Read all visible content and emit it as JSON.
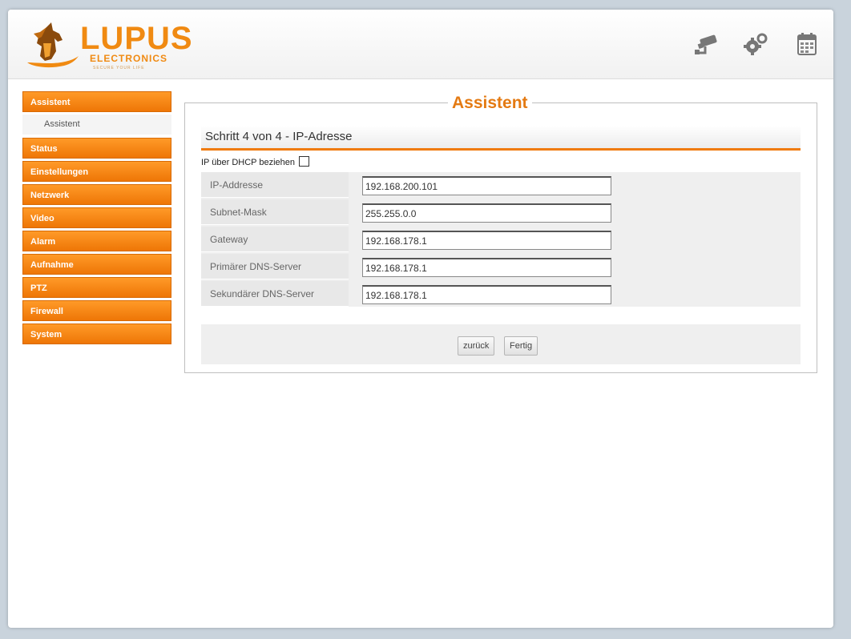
{
  "brand": {
    "name": "LUPUS",
    "sub": "ELECTRONICS",
    "tagline": "SECURE YOUR LIFE",
    "accent_color": "#f08a12"
  },
  "header_icons": [
    "camera-icon",
    "gears-icon",
    "calendar-icon"
  ],
  "nav": {
    "items": [
      {
        "label": "Assistent",
        "active": true,
        "sub": [
          "Assistent"
        ]
      },
      {
        "label": "Status"
      },
      {
        "label": "Einstellungen"
      },
      {
        "label": "Netzwerk"
      },
      {
        "label": "Video"
      },
      {
        "label": "Alarm"
      },
      {
        "label": "Aufnahme"
      },
      {
        "label": "PTZ"
      },
      {
        "label": "Firewall"
      },
      {
        "label": "System"
      }
    ]
  },
  "panel": {
    "title": "Assistent",
    "step": "Schritt 4 von 4 - IP-Adresse",
    "dhcp_label": "IP über DHCP beziehen",
    "dhcp_checked": false,
    "fields": [
      {
        "label": "IP-Addresse",
        "value": "192.168.200.101"
      },
      {
        "label": "Subnet-Mask",
        "value": "255.255.0.0"
      },
      {
        "label": "Gateway",
        "value": "192.168.178.1"
      },
      {
        "label": "Primärer DNS-Server",
        "value": "192.168.178.1"
      },
      {
        "label": "Sekundärer DNS-Server",
        "value": "192.168.178.1"
      }
    ],
    "buttons": {
      "back": "zurück",
      "finish": "Fertig"
    }
  }
}
